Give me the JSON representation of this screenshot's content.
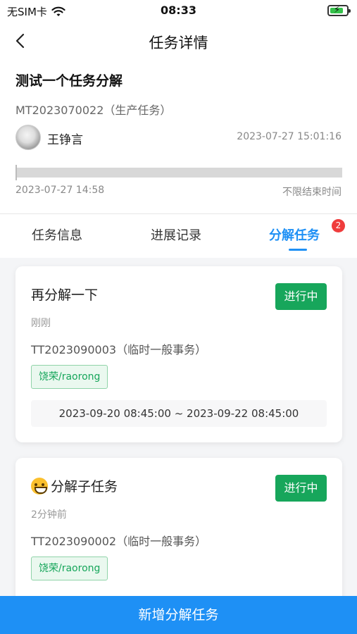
{
  "status_bar": {
    "carrier": "无SIM卡",
    "time": "08:33",
    "wifi_icon": "wifi-icon",
    "battery_icon": "battery-charging-icon",
    "battery_level": 0.8,
    "battery_color": "#35c24b"
  },
  "nav": {
    "title": "任务详情",
    "back_icon": "chevron-left-icon"
  },
  "task": {
    "title": "测试一个任务分解",
    "code": "MT2023070022（生产任务）",
    "owner": "王铮言",
    "created_at": "2023-07-27 15:01:16",
    "start_time": "2023-07-27 14:58",
    "end_time": "不限结束时间",
    "progress": 0
  },
  "tabs": {
    "items": [
      {
        "label": "任务信息"
      },
      {
        "label": "进展记录"
      },
      {
        "label": "分解任务"
      }
    ],
    "active_index": 2,
    "badge": "2",
    "active_color": "#1e90f5",
    "badge_color": "#ef3c3c"
  },
  "subtasks": [
    {
      "title": "再分解一下",
      "status": "进行中",
      "time_ago": "刚刚",
      "code": "TT2023090003（临时一般事务）",
      "assignee": "饶荣/raorong",
      "date_range": "2023-09-20 08:45:00  ~  2023-09-22 08:45:00"
    },
    {
      "title": "分解子任务",
      "title_icon": "grinning-face-icon",
      "status": "进行中",
      "time_ago": "2分钟前",
      "code": "TT2023090002（临时一般事务）",
      "assignee": "饶荣/raorong"
    }
  ],
  "colors": {
    "status_green": "#17a65b",
    "primary_blue": "#1e90f5"
  },
  "bottom_button": {
    "label": "新增分解任务"
  }
}
